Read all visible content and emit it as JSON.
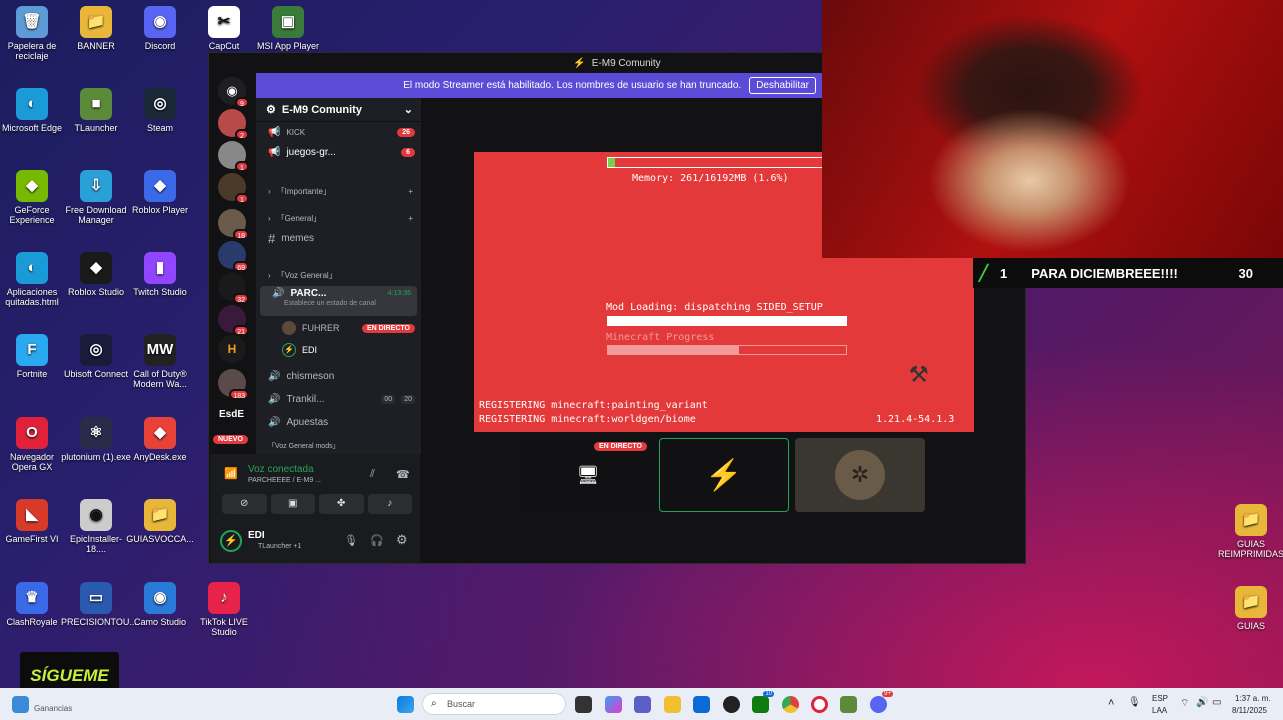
{
  "desktop": {
    "icons": [
      {
        "label": "Papelera de reciclaje",
        "glyph": "🗑",
        "color": "#5e9bd6"
      },
      {
        "label": "BANNER",
        "glyph": "📁",
        "color": "#e8b73a"
      },
      {
        "label": "Discord",
        "glyph": "◉",
        "color": "#5865f2"
      },
      {
        "label": "CapCut",
        "glyph": "✂",
        "color": "#ffffff"
      },
      {
        "label": "MSI App Player",
        "glyph": "▣",
        "color": "#3a7a3a"
      },
      {
        "label": "Microsoft Edge",
        "glyph": "◐",
        "color": "#1a9bd7"
      },
      {
        "label": "TLauncher",
        "glyph": "■",
        "color": "#5a8a3a"
      },
      {
        "label": "Steam",
        "glyph": "◎",
        "color": "#1b2838"
      },
      {
        "label": "GeForce Experience",
        "glyph": "◆",
        "color": "#76b900"
      },
      {
        "label": "Free Download Manager",
        "glyph": "⇩",
        "color": "#2aa0d8"
      },
      {
        "label": "Roblox Player",
        "glyph": "◆",
        "color": "#3a6ae8"
      },
      {
        "label": "Aplicaciones quitadas.html",
        "glyph": "◐",
        "color": "#1a9bd7"
      },
      {
        "label": "Roblox Studio",
        "glyph": "◆",
        "color": "#1a1a1a"
      },
      {
        "label": "Twitch Studio",
        "glyph": "▮",
        "color": "#9146ff"
      },
      {
        "label": "Fortnite",
        "glyph": "F",
        "color": "#2aa8f0"
      },
      {
        "label": "Ubisoft Connect",
        "glyph": "◎",
        "color": "#1a1a3a"
      },
      {
        "label": "Call of Duty® Modern Wa...",
        "glyph": "MW",
        "color": "#222222"
      },
      {
        "label": "Navegador Opera GX",
        "glyph": "O",
        "color": "#e0213a"
      },
      {
        "label": "plutonium (1).exe",
        "glyph": "⚛",
        "color": "#2a2a4a"
      },
      {
        "label": "AnyDesk.exe",
        "glyph": "◆",
        "color": "#e8413a"
      },
      {
        "label": "GameFirst VI",
        "glyph": "◣",
        "color": "#d83a2a"
      },
      {
        "label": "EpicInstaller-18....",
        "glyph": "◉",
        "color": "#cccccc"
      },
      {
        "label": "GUIASVOCCA...",
        "glyph": "📁",
        "color": "#e8b73a"
      },
      {
        "label": "ClashRoyale",
        "glyph": "♛",
        "color": "#3a6ae8"
      },
      {
        "label": "PRECISIONTOU...",
        "glyph": "▭",
        "color": "#2a5ab0"
      },
      {
        "label": "Camo Studio",
        "glyph": "◉",
        "color": "#2a7ad8"
      },
      {
        "label": "TikTok LIVE Studio",
        "glyph": "♪",
        "color": "#e8234a"
      },
      {
        "label": "GUIAS REIMPRIMIDAS",
        "glyph": "📁",
        "color": "#e8b73a"
      },
      {
        "label": "GUIAS",
        "glyph": "📁",
        "color": "#e8b73a"
      }
    ],
    "sigueme_text": "SÍGUEME",
    "ganancias_text": "Ganancias"
  },
  "discord": {
    "window_title": "E-M9 Comunity",
    "banner_text": "El modo Streamer está habilitado. Los nombres de usuario se han truncado.",
    "banner_button": "Deshabilitar",
    "server_name": "E-M9 Comunity",
    "server_badges": [
      "9",
      "2",
      "1",
      "1",
      "18",
      "69",
      "32",
      "21",
      "183"
    ],
    "server_label_esde": "EsdE",
    "server_label_nuevo": "NUEVO",
    "channels": {
      "kick": "KICK",
      "kick_badge": "26",
      "juegos": "juegos-gr...",
      "juegos_badge": "6",
      "importante": "「Importante」",
      "general_cat": "「General」",
      "memes": "memes",
      "voz_general": "「Voz General」",
      "parc": "PARC...",
      "parc_time": "4:13:36",
      "parc_status": "Establece un estado de canal",
      "user_fuhrer": "FUHRER",
      "en_directo": "EN DIRECTO",
      "user_edi": "EDI",
      "chismeson": "chismeson",
      "trankil": "Trankil...",
      "trankil_count_a": "00",
      "trankil_count_b": "20",
      "apuestas": "Apuestas",
      "voz_general_mods": "「Voz General mods」"
    },
    "voice_panel": {
      "status": "Voz conectada",
      "channel": "PARCHEEEE / E-M9 ...",
      "user": "EDI",
      "activity": "TLauncher +1"
    },
    "stream": {
      "memory": "Memory: 261/16192MB (1.6%)",
      "mod_loading": "Mod Loading: dispatching SIDED_SETUP",
      "minecraft_progress": "Minecraft Progress",
      "reg1": "REGISTERING minecraft:painting_variant",
      "reg2": "REGISTERING minecraft:worldgen/biome",
      "version": "1.21.4-54.1.3",
      "loading_progress": 1.0,
      "minecraft_progress_value": 0.55
    },
    "tile_live_label": "EN DIRECTO"
  },
  "overlay": {
    "count_left": "1",
    "message": "PARA DICIEMBREEE!!!!",
    "count_right": "30"
  },
  "taskbar": {
    "search_placeholder": "Buscar",
    "lang_top": "ESP",
    "lang_bottom": "LAA",
    "time": "1:37 a. m.",
    "date": "8/11/2025",
    "badge_xbox": "10",
    "badge_discord": "9+"
  },
  "colors": {
    "discord_blurple": "#5c4bd6",
    "live_red": "#e03a3e",
    "mc_red": "#e4393a",
    "voice_green": "#23a559"
  }
}
